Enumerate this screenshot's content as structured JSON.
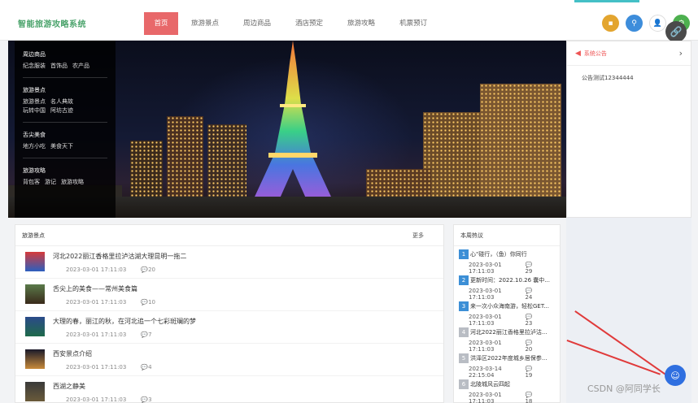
{
  "header": {
    "logo": "智能旅游攻略系统",
    "nav": [
      "首页",
      "旅游景点",
      "周边商品",
      "酒店预定",
      "旅游攻略",
      "机票预订"
    ],
    "active_index": 0,
    "link_glyph": "🔗"
  },
  "menu": [
    {
      "title": "周边商品",
      "subs": [
        "纪念服装",
        "首饰品",
        "农产品"
      ]
    },
    {
      "title": "旅游景点",
      "subs": [
        "旅游景点",
        "名人典故",
        "玩转中国",
        "阿坊古迹"
      ]
    },
    {
      "title": "舌尖美食",
      "subs": [
        "地方小吃",
        "美食天下"
      ]
    },
    {
      "title": "旅游攻略",
      "subs": [
        "背包客",
        "游记",
        "旅游攻略"
      ]
    }
  ],
  "notice": {
    "title": "系统公告",
    "more": "›",
    "content": "公告测试12344444"
  },
  "attractions": {
    "title": "旅游景点",
    "more": "更多",
    "items": [
      {
        "title": "河北2022丽江香格里拉泸沽湖大理昆明一拖二",
        "time": "2023-03-01 17:11:03",
        "comments": "20"
      },
      {
        "title": "舌尖上的美食——常州美食篇",
        "time": "2023-03-01 17:11:03",
        "comments": "10"
      },
      {
        "title": "大理的春，丽江的秋，在河北追一个七彩斑斓的梦",
        "time": "2023-03-01 17:11:03",
        "comments": "7"
      },
      {
        "title": "西安景点介绍",
        "time": "2023-03-01 17:11:03",
        "comments": "4"
      },
      {
        "title": "西湖之静美",
        "time": "2023-03-01 17:11:03",
        "comments": "3"
      }
    ]
  },
  "hot": {
    "title": "本周热议",
    "items": [
      {
        "rank": "1",
        "title": "心\"碰行，（鱼）你同行",
        "time": "2023-03-01 17:11:03",
        "comments": "29"
      },
      {
        "rank": "2",
        "title": "更新时间：2022.10.26 囊中...",
        "time": "2023-03-01 17:11:03",
        "comments": "24"
      },
      {
        "rank": "3",
        "title": "来一次小众海南游，轻松GET...",
        "time": "2023-03-01 17:11:03",
        "comments": "23"
      },
      {
        "rank": "4",
        "title": "河北2022丽江香格里拉泸沽...",
        "time": "2023-03-01 17:11:03",
        "comments": "20"
      },
      {
        "rank": "5",
        "title": "洪泽区2022年度城乡居保参...",
        "time": "2023-03-14 22:15:04",
        "comments": "19"
      },
      {
        "rank": "6",
        "title": "北陵城风云四起",
        "time": "2023-03-01 17:11:03",
        "comments": "18"
      }
    ]
  },
  "watermark": "CSDN @阿同学长",
  "colors": {
    "accent": "#e8686a",
    "logo": "#4aa36b",
    "rank_top": "#3c8fd6",
    "arrow": "#e03a3a"
  }
}
